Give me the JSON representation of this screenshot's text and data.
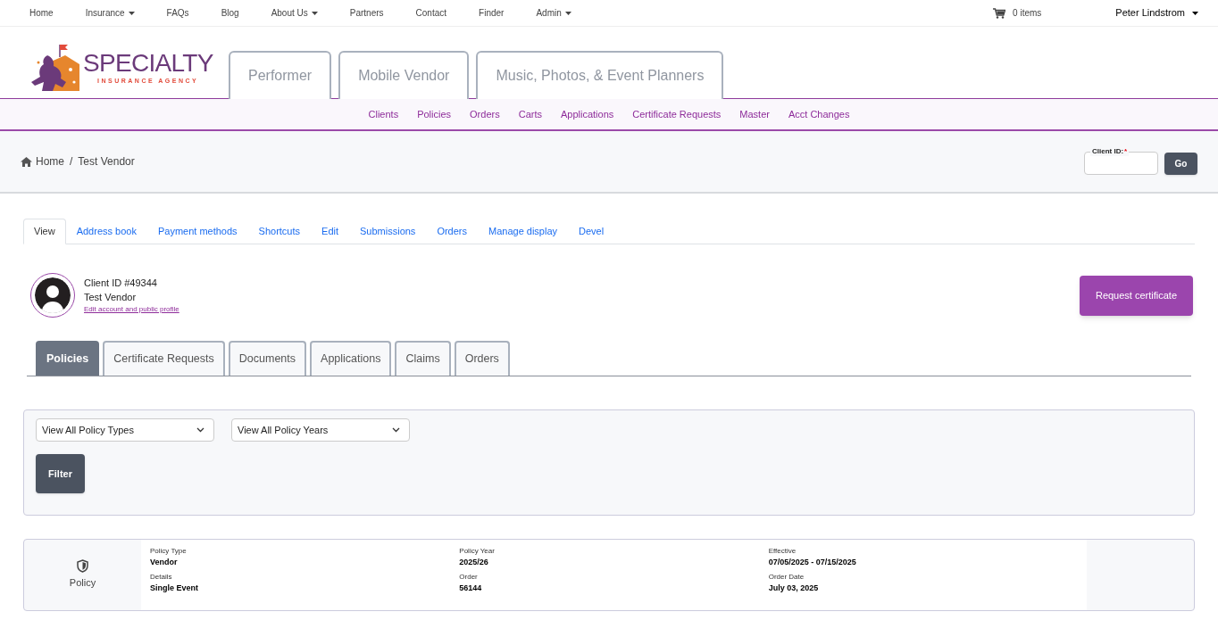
{
  "top_nav": {
    "items": [
      {
        "label": "Home",
        "dropdown": false
      },
      {
        "label": "Insurance",
        "dropdown": true
      },
      {
        "label": "FAQs",
        "dropdown": false
      },
      {
        "label": "Blog",
        "dropdown": false
      },
      {
        "label": "About Us",
        "dropdown": true
      },
      {
        "label": "Partners",
        "dropdown": false
      },
      {
        "label": "Contact",
        "dropdown": false
      },
      {
        "label": "Finder",
        "dropdown": false
      },
      {
        "label": "Admin",
        "dropdown": true
      }
    ],
    "cart": "0 items",
    "user": "Peter Lindstrom"
  },
  "logo": {
    "name": "SPECIALTY",
    "tagline": "INSURANCE AGENCY"
  },
  "site_tabs": [
    "Performer",
    "Mobile Vendor",
    "Music, Photos, & Event Planners"
  ],
  "admin_nav": [
    "Clients",
    "Policies",
    "Orders",
    "Carts",
    "Applications",
    "Certificate Requests",
    "Master",
    "Acct Changes"
  ],
  "breadcrumb": {
    "items": [
      "Home",
      "Test Vendor"
    ],
    "separator": "/"
  },
  "client_id_field": {
    "label": "Client ID:",
    "required": true,
    "required_mark": "*",
    "button": "Go"
  },
  "page_tabs": [
    {
      "label": "View",
      "selected": true
    },
    {
      "label": "Address book",
      "selected": false
    },
    {
      "label": "Payment methods",
      "selected": false
    },
    {
      "label": "Shortcuts",
      "selected": false
    },
    {
      "label": "Edit",
      "selected": false
    },
    {
      "label": "Submissions",
      "selected": false
    },
    {
      "label": "Orders",
      "selected": false
    },
    {
      "label": "Manage display",
      "selected": false
    },
    {
      "label": "Devel",
      "selected": false
    }
  ],
  "profile": {
    "client_id": "Client ID #49344",
    "name": "Test Vendor",
    "edit_link": "Edit account and public profile",
    "button": "Request certificate"
  },
  "section_tabs": [
    {
      "label": "Policies",
      "selected": true
    },
    {
      "label": "Certificate Requests",
      "selected": false
    },
    {
      "label": "Documents",
      "selected": false
    },
    {
      "label": "Applications",
      "selected": false
    },
    {
      "label": "Claims",
      "selected": false
    },
    {
      "label": "Orders",
      "selected": false
    }
  ],
  "filters": {
    "selects": [
      "View All Policy Types",
      "View All Policy Years"
    ],
    "button": "Filter"
  },
  "policies": [
    {
      "label": "Policy",
      "fields": [
        {
          "label": "Policy Type",
          "value": "Vendor"
        },
        {
          "label": "Policy Year",
          "value": "2025/26"
        },
        {
          "label": "Effective",
          "value": "07/05/2025 - 07/15/2025"
        },
        {
          "label": "Details",
          "value": "Single Event"
        },
        {
          "label": "Order",
          "value": "56144"
        },
        {
          "label": "Order Date",
          "value": "July 03, 2025"
        }
      ]
    }
  ]
}
